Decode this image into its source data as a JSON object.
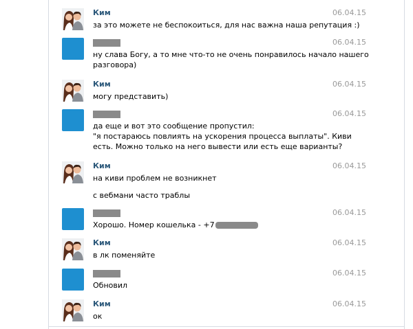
{
  "messages": [
    {
      "author": "Ким",
      "date": "06.04.15",
      "lines": [
        "за это можете не беспокоиться, для нас важна наша репутация :)"
      ]
    },
    {
      "author": "",
      "date": "06.04.15",
      "lines": [
        "ну слава Богу, а то мне что-то не очень понравилось начало нашего",
        "разговора)"
      ]
    },
    {
      "author": "Ким",
      "date": "06.04.15",
      "lines": [
        "могу представить)"
      ]
    },
    {
      "author": "",
      "date": "06.04.15",
      "lines": [
        "да еще и вот это сообщение пропустил:",
        "\"я постараюсь повлиять на ускорения процесса выплаты\". Киви",
        "есть. Можно только на него вывести или есть еще варианты?"
      ]
    },
    {
      "author": "Ким",
      "date": "06.04.15",
      "lines": [
        "на киви проблем не возникнет",
        "",
        "с вебмани часто траблы"
      ]
    },
    {
      "author": "",
      "date": "06.04.15",
      "lines": [
        "Хорошо. Номер кошелька - +7"
      ]
    },
    {
      "author": "Ким",
      "date": "06.04.15",
      "lines": [
        "в лк поменяйте"
      ]
    },
    {
      "author": "",
      "date": "06.04.15",
      "lines": [
        "Обновил"
      ]
    },
    {
      "author": "Ким",
      "date": "06.04.15",
      "lines": [
        "ок"
      ]
    }
  ],
  "colors": {
    "author": "#2b587a",
    "date": "#999999",
    "user_avatar": "#1e8fd0",
    "redaction": "#8a8a8a"
  },
  "icons": {
    "kim_avatar": "couple-photo-avatar-icon",
    "user_avatar": "blue-square-avatar-icon"
  }
}
